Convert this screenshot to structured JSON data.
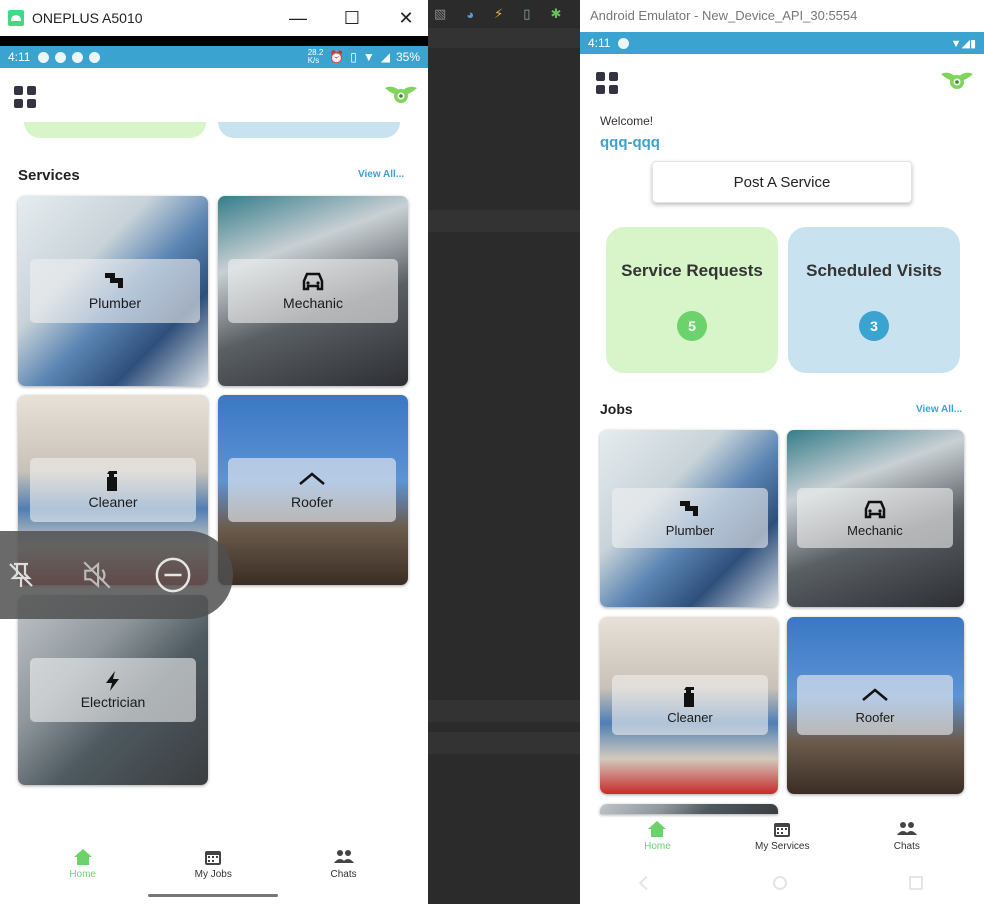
{
  "left_window": {
    "title": "ONEPLUS A5010",
    "status_bar": {
      "time": "4:11",
      "network_speed": "28.2\nK/s",
      "battery": "35%"
    },
    "services": {
      "heading": "Services",
      "view_all": "View All...",
      "cards": [
        {
          "label": "Plumber",
          "icon": "pipe-icon"
        },
        {
          "label": "Mechanic",
          "icon": "car-icon"
        },
        {
          "label": "Cleaner",
          "icon": "spray-bottle-icon"
        },
        {
          "label": "Roofer",
          "icon": "roof-icon"
        },
        {
          "label": "Electrician",
          "icon": "lightning-icon"
        }
      ]
    },
    "bottom_nav": [
      {
        "label": "Home",
        "icon": "home-icon",
        "active": true
      },
      {
        "label": "My Jobs",
        "icon": "calendar-icon",
        "active": false
      },
      {
        "label": "Chats",
        "icon": "people-icon",
        "active": false
      }
    ]
  },
  "right_window": {
    "title": "Android Emulator - New_Device_API_30:5554",
    "status_bar": {
      "time": "4:11"
    },
    "welcome": "Welcome!",
    "username": "qqq-qqq",
    "post_button": "Post A Service",
    "stats": [
      {
        "title": "Service Requests",
        "count": "5",
        "bg": "#d7f5c9",
        "badge": "#6cd36c"
      },
      {
        "title": "Scheduled Visits",
        "count": "3",
        "bg": "#c9e2ef",
        "badge": "#3aa3cf"
      }
    ],
    "jobs": {
      "heading": "Jobs",
      "view_all": "View All...",
      "cards": [
        {
          "label": "Plumber",
          "icon": "pipe-icon"
        },
        {
          "label": "Mechanic",
          "icon": "car-icon"
        },
        {
          "label": "Cleaner",
          "icon": "spray-bottle-icon"
        },
        {
          "label": "Roofer",
          "icon": "roof-icon"
        }
      ]
    },
    "bottom_nav": [
      {
        "label": "Home",
        "icon": "home-icon",
        "active": true
      },
      {
        "label": "My Services",
        "icon": "calendar-icon",
        "active": false
      },
      {
        "label": "Chats",
        "icon": "people-icon",
        "active": false
      }
    ]
  },
  "colors": {
    "accent_blue": "#3aa3cf",
    "accent_green": "#6cd36c",
    "pill_green": "#d7f5c9",
    "pill_blue": "#c9e2ef"
  }
}
